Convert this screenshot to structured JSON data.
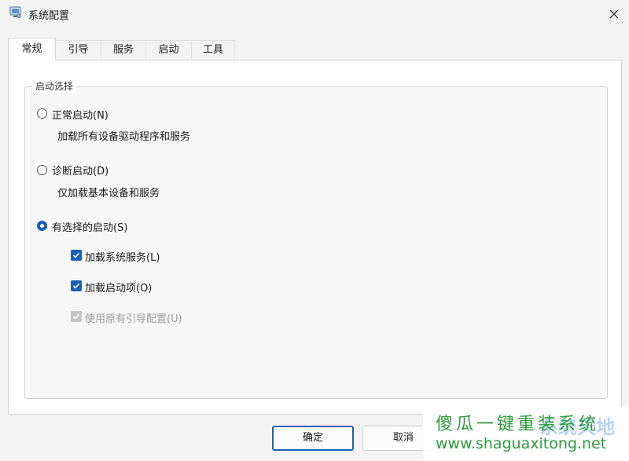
{
  "window": {
    "title": "系统配置",
    "icon": "msconfig-icon",
    "close_icon": "close-icon"
  },
  "tabs": [
    {
      "label": "常规",
      "active": true
    },
    {
      "label": "引导",
      "active": false
    },
    {
      "label": "服务",
      "active": false
    },
    {
      "label": "启动",
      "active": false
    },
    {
      "label": "工具",
      "active": false
    }
  ],
  "startup_selection": {
    "group_label": "启动选择",
    "options": [
      {
        "label": "正常启动(N)",
        "description": "加载所有设备驱动程序和服务",
        "selected": false
      },
      {
        "label": "诊断启动(D)",
        "description": "仅加载基本设备和服务",
        "selected": false
      },
      {
        "label": "有选择的启动(S)",
        "selected": true
      }
    ],
    "selective_items": [
      {
        "label": "加载系统服务(L)",
        "checked": true,
        "enabled": true
      },
      {
        "label": "加载启动项(O)",
        "checked": true,
        "enabled": true
      },
      {
        "label": "使用原有引导配置(U)",
        "checked": true,
        "enabled": false
      }
    ]
  },
  "buttons": {
    "ok": "确定",
    "cancel": "取消"
  },
  "watermark": {
    "text": "傻瓜一键重装系统",
    "url": "www.shaguaxitong.net",
    "logo_text": "系统天地"
  },
  "colors": {
    "accent": "#1a5fb4",
    "watermark_green": "#2d9b3a"
  }
}
